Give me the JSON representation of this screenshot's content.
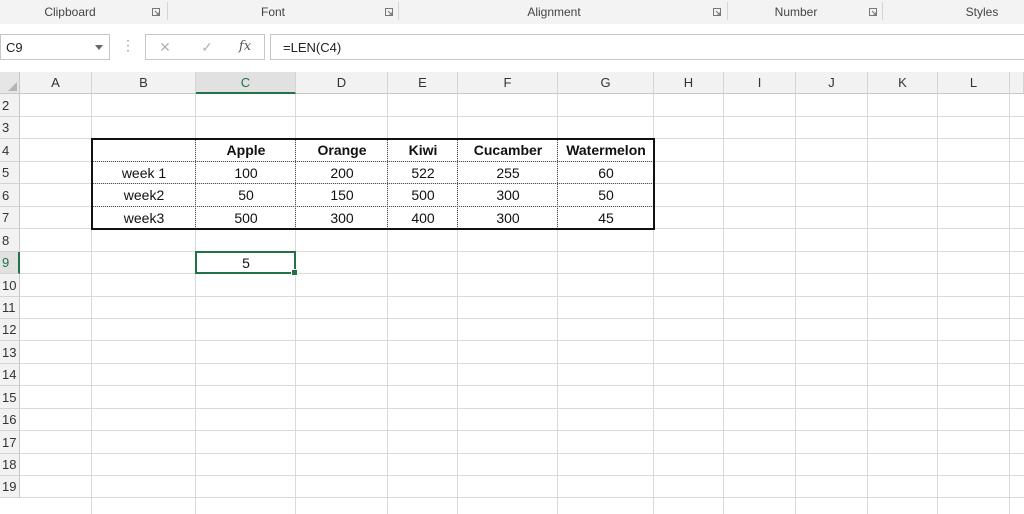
{
  "ribbon": {
    "groups": [
      "Clipboard",
      "Font",
      "Alignment",
      "Number",
      "Styles"
    ]
  },
  "formula_bar": {
    "name_box": "C9",
    "cancel_icon": "x-icon",
    "enter_icon": "check-icon",
    "function_label": "fx",
    "formula": "=LEN(C4)"
  },
  "sheet": {
    "columns": [
      "A",
      "B",
      "C",
      "D",
      "E",
      "F",
      "G",
      "H",
      "I",
      "J",
      "K",
      "L"
    ],
    "active_column": "C",
    "rows": [
      "2",
      "3",
      "4",
      "5",
      "6",
      "7",
      "8",
      "9",
      "10",
      "11",
      "12",
      "13",
      "14",
      "15",
      "16",
      "17",
      "18",
      "19"
    ],
    "active_row": "9",
    "table": {
      "headers": [
        "Apple",
        "Orange",
        "Kiwi",
        "Cucamber",
        "Watermelon"
      ],
      "rows": [
        {
          "label": "week 1",
          "values": [
            "100",
            "200",
            "522",
            "255",
            "60"
          ]
        },
        {
          "label": "week2",
          "values": [
            "50",
            "150",
            "500",
            "300",
            "50"
          ]
        },
        {
          "label": "week3",
          "values": [
            "500",
            "300",
            "400",
            "300",
            "45"
          ]
        }
      ]
    },
    "selected_cell": {
      "ref": "C9",
      "value": "5"
    },
    "accent_color": "#217346"
  }
}
